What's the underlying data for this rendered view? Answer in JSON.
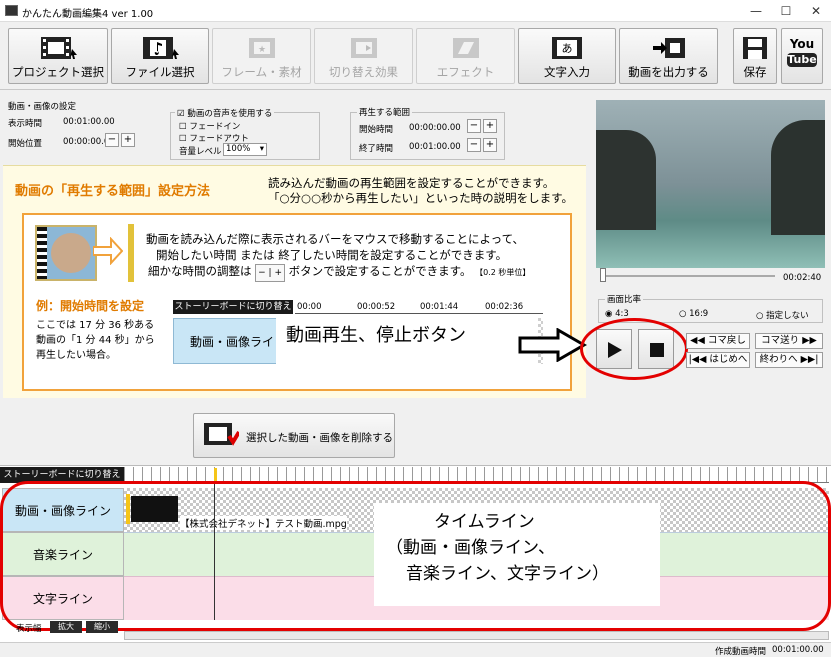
{
  "window": {
    "title": "かんたん動画編集4 ver 1.00"
  },
  "toolbar": {
    "project": "プロジェクト選択",
    "file": "ファイル選択",
    "frame": "フレーム・素材",
    "transition": "切り替え効果",
    "effect": "エフェクト",
    "text": "文字入力",
    "export": "動画を出力する",
    "save": "保存",
    "youtube_line1": "You",
    "youtube_line2": "Tube"
  },
  "settings": {
    "heading": "動画・画像の設定",
    "display_time_label": "表示時間",
    "display_time_value": "00:01:00.00",
    "start_pos_label": "開始位置",
    "start_pos_value": "00:00:00.00",
    "use_audio": "動画の音声を使用する",
    "fade_in": "フェードイン",
    "fade_out": "フェードアウト",
    "volume_label": "音量レベル",
    "volume_value": "100%",
    "range_title": "再生する範囲",
    "range_start_label": "開始時間",
    "range_start_value": "00:00:00.00",
    "range_end_label": "終了時間",
    "range_end_value": "00:01:00.00"
  },
  "guide": {
    "title": "動画の「再生する範囲」設定方法",
    "intro1": "読み込んだ動画の再生範囲を設定することができます。",
    "intro2": "「○分○○秒から再生したい」といった時の説明をします。",
    "body1": "動画を読み込んだ際に表示されるバーをマウスで移動することによって、",
    "body2": "開始したい時間 または 終了したい時間を設定することができます。",
    "body3a": "細かな時間の調整は",
    "body3b": "ボタンで設定することができます。",
    "body3c": "【0.2 秒単位】",
    "example_title": "例：開始時間を設定",
    "example1": "ここでは 17 分 36 秒ある",
    "example2": "動画の「1 分 44 秒」から",
    "example3": "再生したい場合。",
    "storyboard_switch": "ストーリーボードに切り替え",
    "mini_line": "動画・画像ライ",
    "mini_ticks": [
      "00:00",
      "00:00:52",
      "00:01:44",
      "00:02:36"
    ],
    "annotation": "動画再生、停止ボタン"
  },
  "delete_button": "選択した動画・画像を削除する",
  "preview": {
    "time": "00:02:40",
    "ratio_label": "画面比率",
    "ratio_options": [
      "4:3",
      "16:9",
      "指定しない"
    ],
    "prev_frame": "コマ戻し",
    "next_frame": "コマ送り",
    "to_start": "はじめへ",
    "to_end": "終わりへ"
  },
  "timeline": {
    "storyboard_switch": "ストーリーボードに切り替え",
    "video_line": "動画・画像ライン",
    "music_line": "音楽ライン",
    "text_line": "文字ライン",
    "clip_name": "【株式会社デネット】テスト動画.mpg",
    "annotation1": "タイムライン",
    "annotation2": "（動画・画像ライン、",
    "annotation3": "音楽ライン、文字ライン）",
    "zoom_label": "表示幅",
    "zoom_in": "拡大",
    "zoom_out": "縮小"
  },
  "footer": {
    "duration_label": "作成動画時間",
    "duration_value": "00:01:00.00"
  },
  "colors": {
    "accent_red": "#e30000",
    "guide_orange": "#e07b00",
    "video_lane": "#c9e6f6",
    "music_lane": "#dff2da",
    "text_lane": "#fbdde8"
  }
}
